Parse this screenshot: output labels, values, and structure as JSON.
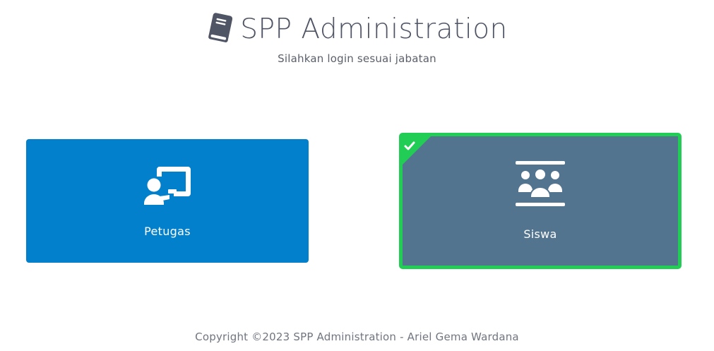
{
  "header": {
    "title": "SPP Administration",
    "subtitle": "Silahkan login sesuai jabatan",
    "logo_icon": "book-icon"
  },
  "roles": [
    {
      "label": "Petugas",
      "icon": "chalkboard-teacher-icon",
      "selected": false,
      "color": "#0380cb"
    },
    {
      "label": "Siswa",
      "icon": "people-group-icon",
      "selected": true,
      "color": "#53748f"
    }
  ],
  "colors": {
    "selected_border": "#22cd55",
    "title_text": "#505566"
  },
  "footer": {
    "copyright": "Copyright ©2023 SPP Administration - Ariel Gema Wardana"
  }
}
